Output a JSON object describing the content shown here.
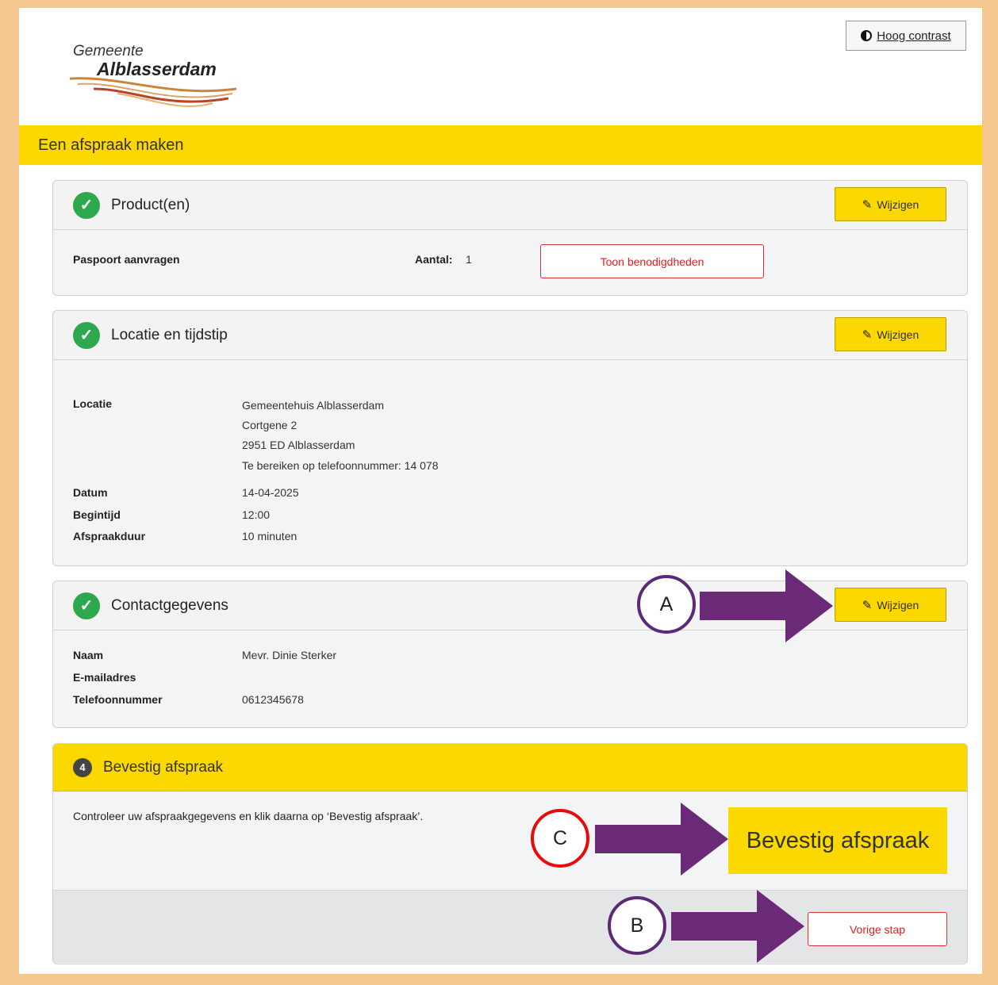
{
  "header": {
    "logo_line1": "Gemeente",
    "logo_line2": "Alblasserdam",
    "contrast_button": "Hoog contrast",
    "page_title": "Een afspraak maken"
  },
  "products": {
    "title": "Product(en)",
    "edit_label": "Wijzigen",
    "item_name": "Paspoort aanvragen",
    "aantal_label": "Aantal:",
    "aantal_value": "1",
    "toon_button": "Toon benodigdheden"
  },
  "location": {
    "title": "Locatie en tijdstip",
    "edit_label": "Wijzigen",
    "locatie_label": "Locatie",
    "address_lines": [
      "Gemeentehuis Alblasserdam",
      "Cortgene 2",
      "2951 ED Alblasserdam",
      "Te bereiken op telefoonnummer: 14 078"
    ],
    "datum_label": "Datum",
    "datum_value": "14-04-2025",
    "begintijd_label": "Begintijd",
    "begintijd_value": "12:00",
    "duur_label": "Afspraakduur",
    "duur_value": "10 minuten"
  },
  "contact": {
    "title": "Contactgegevens",
    "edit_label": "Wijzigen",
    "naam_label": "Naam",
    "naam_value": "Mevr. Dinie Sterker",
    "email_label": "E-mailadres",
    "email_value": "",
    "telefoon_label": "Telefoonnummer",
    "telefoon_value": "0612345678"
  },
  "confirm": {
    "step_number": "4",
    "title": "Bevestig afspraak",
    "instruction": "Controleer uw afspraakgegevens en klik daarna op ‘Bevestig afspraak’.",
    "confirm_button": "Bevestig afspraak",
    "back_button": "Vorige stap"
  },
  "annotations": {
    "a": "A",
    "b": "B",
    "c": "C"
  },
  "colors": {
    "brand_yellow": "#fbd800",
    "success_green": "#2ea84d",
    "danger_red": "#e02020",
    "annotation_purple": "#6a2a78",
    "frame_orange": "#f4c690"
  }
}
